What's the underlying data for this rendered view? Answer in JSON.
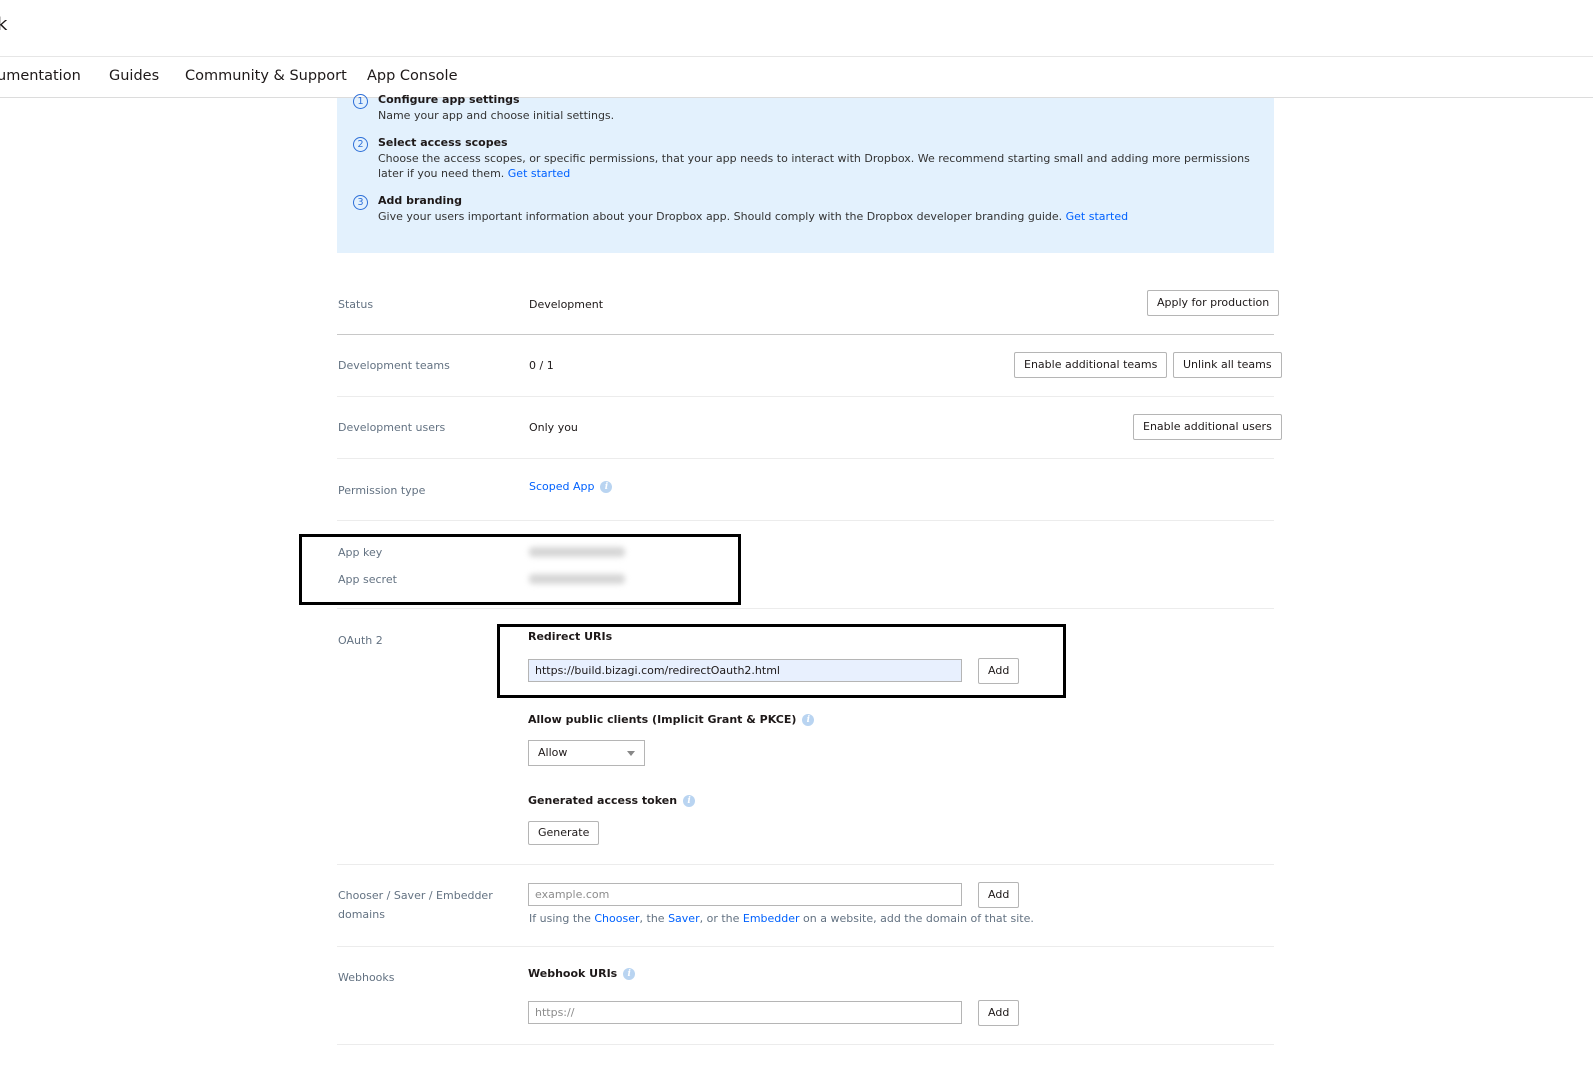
{
  "topbar": {
    "brand_fragment": "k"
  },
  "nav": {
    "items": [
      {
        "label": "umentation"
      },
      {
        "label": "Guides"
      },
      {
        "label": "Community & Support"
      },
      {
        "label": "App Console"
      }
    ]
  },
  "steps": [
    {
      "num": "1",
      "title": "Configure app settings",
      "desc": "Name your app and choose initial settings.",
      "link": ""
    },
    {
      "num": "2",
      "title": "Select access scopes",
      "desc": "Choose the access scopes, or specific permissions, that your app needs to interact with Dropbox. We recommend starting small and adding more permissions later if you need them.",
      "link": "Get started"
    },
    {
      "num": "3",
      "title": "Add branding",
      "desc": "Give your users important information about your Dropbox app. Should comply with the Dropbox developer branding guide.",
      "link": "Get started"
    }
  ],
  "status": {
    "label": "Status",
    "value": "Development",
    "button": "Apply for production"
  },
  "dev_teams": {
    "label": "Development teams",
    "value": "0 / 1",
    "button_enable": "Enable additional teams",
    "button_unlink": "Unlink all teams"
  },
  "dev_users": {
    "label": "Development users",
    "value": "Only you",
    "button": "Enable additional users"
  },
  "permission": {
    "label": "Permission type",
    "value": "Scoped App",
    "info": "i"
  },
  "keys": {
    "app_key_label": "App key",
    "app_secret_label": "App secret"
  },
  "oauth": {
    "label": "OAuth 2",
    "redirect_title": "Redirect URIs",
    "redirect_value": "https://build.bizagi.com/redirectOauth2.html",
    "add": "Add",
    "public_clients_title": "Allow public clients (Implicit Grant & PKCE)",
    "public_clients_value": "Allow",
    "token_title": "Generated access token",
    "generate": "Generate"
  },
  "chooser": {
    "label_line1": "Chooser / Saver / Embedder",
    "label_line2": "domains",
    "placeholder": "example.com",
    "add": "Add",
    "hint_pre": "If using the ",
    "hint_chooser": "Chooser",
    "hint_mid1": ", the ",
    "hint_saver": "Saver",
    "hint_mid2": ", or the ",
    "hint_embedder": "Embedder",
    "hint_post": " on a website, add the domain of that site."
  },
  "webhooks": {
    "label": "Webhooks",
    "title": "Webhook URIs",
    "placeholder": "https://",
    "add": "Add"
  },
  "colors": {
    "accent": "#0061fe",
    "info_bg": "#e3f1fd",
    "annotation": "#000000"
  }
}
